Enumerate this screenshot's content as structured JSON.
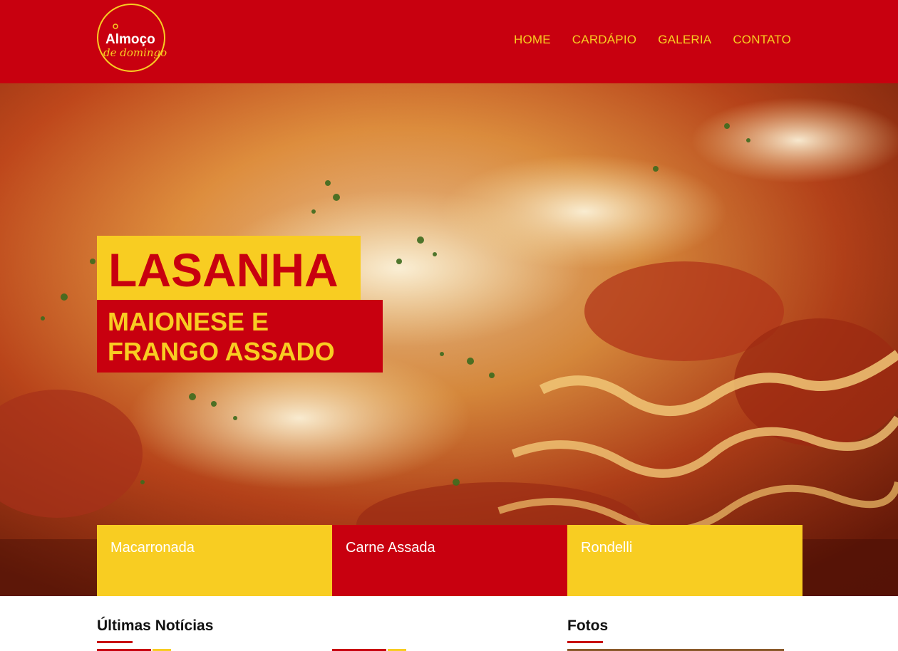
{
  "brand": {
    "logo_line1": "Almoço",
    "logo_line2": "de domingo",
    "colors": {
      "primary": "#c8000f",
      "accent": "#f8cd22"
    }
  },
  "nav": {
    "items": [
      {
        "label": "HOME"
      },
      {
        "label": "CARDÁPIO"
      },
      {
        "label": "GALERIA"
      },
      {
        "label": "CONTATO"
      }
    ]
  },
  "hero": {
    "image": "lasagna-photo",
    "headline": "LASANHA",
    "subheadline": "MAIONESE E FRANGO ASSADO"
  },
  "tiles": [
    {
      "label": "Macarronada",
      "color": "#f8cd22"
    },
    {
      "label": "Carne Assada",
      "color": "#c8000f"
    },
    {
      "label": "Rondelli",
      "color": "#f8cd22"
    }
  ],
  "sections": {
    "news_title": "Últimas Notícias",
    "photos_title": "Fotos"
  }
}
